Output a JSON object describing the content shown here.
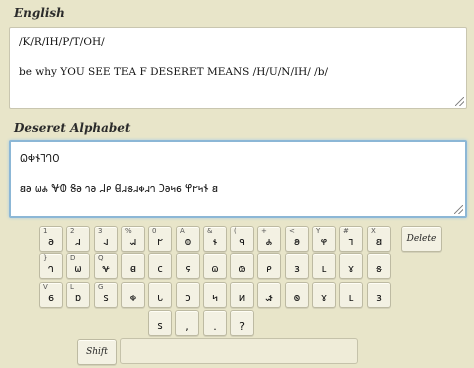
{
  "english": {
    "label": "English",
    "lines": [
      "/K/R/IH/P/T/OH/",
      "be why YOU SEE TEA F DESERET MEANS /H/U/N/IH/ /b/"
    ]
  },
  "deseret": {
    "label": "Deseret Alphabet",
    "lines": [
      "𐐗𐐡𐐆𐐑𐐓𐐄",
      "𐐺𐐨 𐐶𐐴 𐐏𐐅 𐐝𐐨 𐐻𐐨 𐐇𐑁 𐐔𐐯𐑅𐐯𐑉𐐯𐐻 𐐣𐐨𐑌𐑆 𐐐𐐲𐑌𐐆 𐐺"
    ]
  },
  "keyboard": {
    "rows": [
      [
        {
          "sub": "1",
          "main": "𐐨"
        },
        {
          "sub": "2",
          "main": "𐐯"
        },
        {
          "sub": "3",
          "main": "𐐰"
        },
        {
          "sub": "%",
          "main": "𐐱"
        },
        {
          "sub": "0",
          "main": "𐐲"
        },
        {
          "sub": "A",
          "main": "𐐭"
        },
        {
          "sub": "&",
          "main": "𐐮"
        },
        {
          "sub": "(",
          "main": "𐐳"
        },
        {
          "sub": "+",
          "main": "𐐴"
        },
        {
          "sub": "<",
          "main": "𐐵"
        },
        {
          "sub": "Y",
          "main": "𐐸"
        },
        {
          "sub": "#",
          "main": "𐐹"
        },
        {
          "sub": "X",
          "main": "𐐺"
        }
      ],
      [
        {
          "sub": "}",
          "main": "𐐻"
        },
        {
          "sub": "D",
          "main": "𐐶"
        },
        {
          "sub": "Q",
          "main": "𐐷"
        },
        {
          "sub": "",
          "main": "𐐼"
        },
        {
          "sub": "",
          "main": "𐐽"
        },
        {
          "sub": "",
          "main": "𐐾"
        },
        {
          "sub": "",
          "main": "𐐿"
        },
        {
          "sub": "",
          "main": "𐑀"
        },
        {
          "sub": "",
          "main": "𐑁"
        },
        {
          "sub": "",
          "main": "𐑂"
        },
        {
          "sub": "",
          "main": "𐑃"
        },
        {
          "sub": "",
          "main": "𐑄"
        },
        {
          "sub": "",
          "main": "𐑅"
        }
      ],
      [
        {
          "sub": "V",
          "main": "𐑆"
        },
        {
          "sub": "L",
          "main": "𐑇"
        },
        {
          "sub": "G",
          "main": "𐑈"
        },
        {
          "sub": "",
          "main": "𐑉"
        },
        {
          "sub": "",
          "main": "𐑊"
        },
        {
          "sub": "",
          "main": "𐑋"
        },
        {
          "sub": "",
          "main": "𐑌"
        },
        {
          "sub": "",
          "main": "𐑍"
        },
        {
          "sub": "",
          "main": "𐑎"
        },
        {
          "sub": "",
          "main": "𐑏"
        },
        {
          "sub": "",
          "main": "𐑄"
        },
        {
          "sub": "",
          "main": "𐑃"
        },
        {
          "sub": "",
          "main": "𐑂"
        }
      ],
      [
        {
          "sub": "",
          "main": "𐑈"
        },
        {
          "sub": "",
          "main": ","
        },
        {
          "sub": "",
          "main": "."
        },
        {
          "sub": "",
          "main": "?"
        }
      ]
    ],
    "delete_label": "Delete",
    "shift_label": "Shift"
  }
}
